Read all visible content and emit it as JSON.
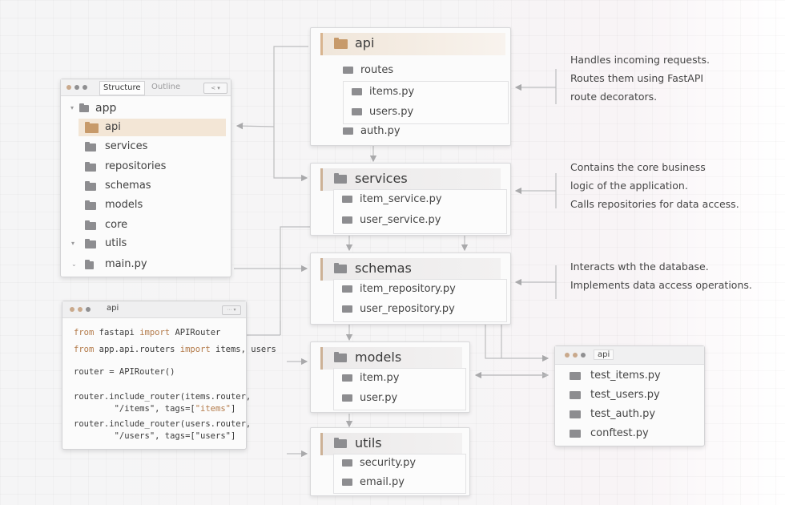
{
  "explorer": {
    "tabs": {
      "structure": "Structure",
      "outline": "Outline"
    },
    "root": "app",
    "items": [
      {
        "label": "api",
        "selected": true
      },
      {
        "label": "services"
      },
      {
        "label": "repositories"
      },
      {
        "label": "schemas"
      },
      {
        "label": "models"
      },
      {
        "label": "core"
      },
      {
        "label": "utils"
      },
      {
        "label": "main.py"
      }
    ]
  },
  "code_window": {
    "tab": "api",
    "lines": [
      {
        "a": "from",
        "b": " fastapi ",
        "c": "import",
        "d": " APIRouter"
      },
      {
        "a": "from",
        "b": " app.api.routers ",
        "c": "import",
        "d": " items, users"
      },
      {
        "plain": "router = APIRouter()"
      },
      {
        "plain": "router.include_router(items.router,"
      },
      {
        "pre": "        \"/items\", tags=[",
        "s": "\"items\"",
        "post": "]"
      },
      {
        "plain": "router.include_router(users.router,"
      },
      {
        "plain": "        \"/users\", tags=[\"users\"]"
      }
    ]
  },
  "modules": {
    "api": {
      "title": "api",
      "items": [
        "routes",
        "items.py",
        "users.py",
        "auth.py"
      ]
    },
    "services": {
      "title": "services",
      "items": [
        "item_service.py",
        "user_service.py"
      ]
    },
    "schemas": {
      "title": "schemas",
      "items": [
        "item_repository.py",
        "user_repository.py"
      ]
    },
    "models": {
      "title": "models",
      "items": [
        "item.py",
        "user.py"
      ]
    },
    "utils": {
      "title": "utils",
      "items": [
        "security.py",
        "email.py"
      ]
    }
  },
  "notes": {
    "api": [
      "Handles incoming requests.",
      "Routes them using FastAPI",
      "route decorators."
    ],
    "services": [
      "Contains the core business",
      "logic of the application.",
      "Calls repositories for data access."
    ],
    "schemas": [
      "Interacts wth the database.",
      "Implements data access operations."
    ]
  },
  "tests": {
    "tab": "api",
    "items": [
      "test_items.py",
      "test_users.py",
      "test_auth.py",
      "conftest.py"
    ]
  },
  "colors": {
    "accent": "#c79a6a",
    "folder": "#8d8d90",
    "line": "#b9b9bb"
  }
}
